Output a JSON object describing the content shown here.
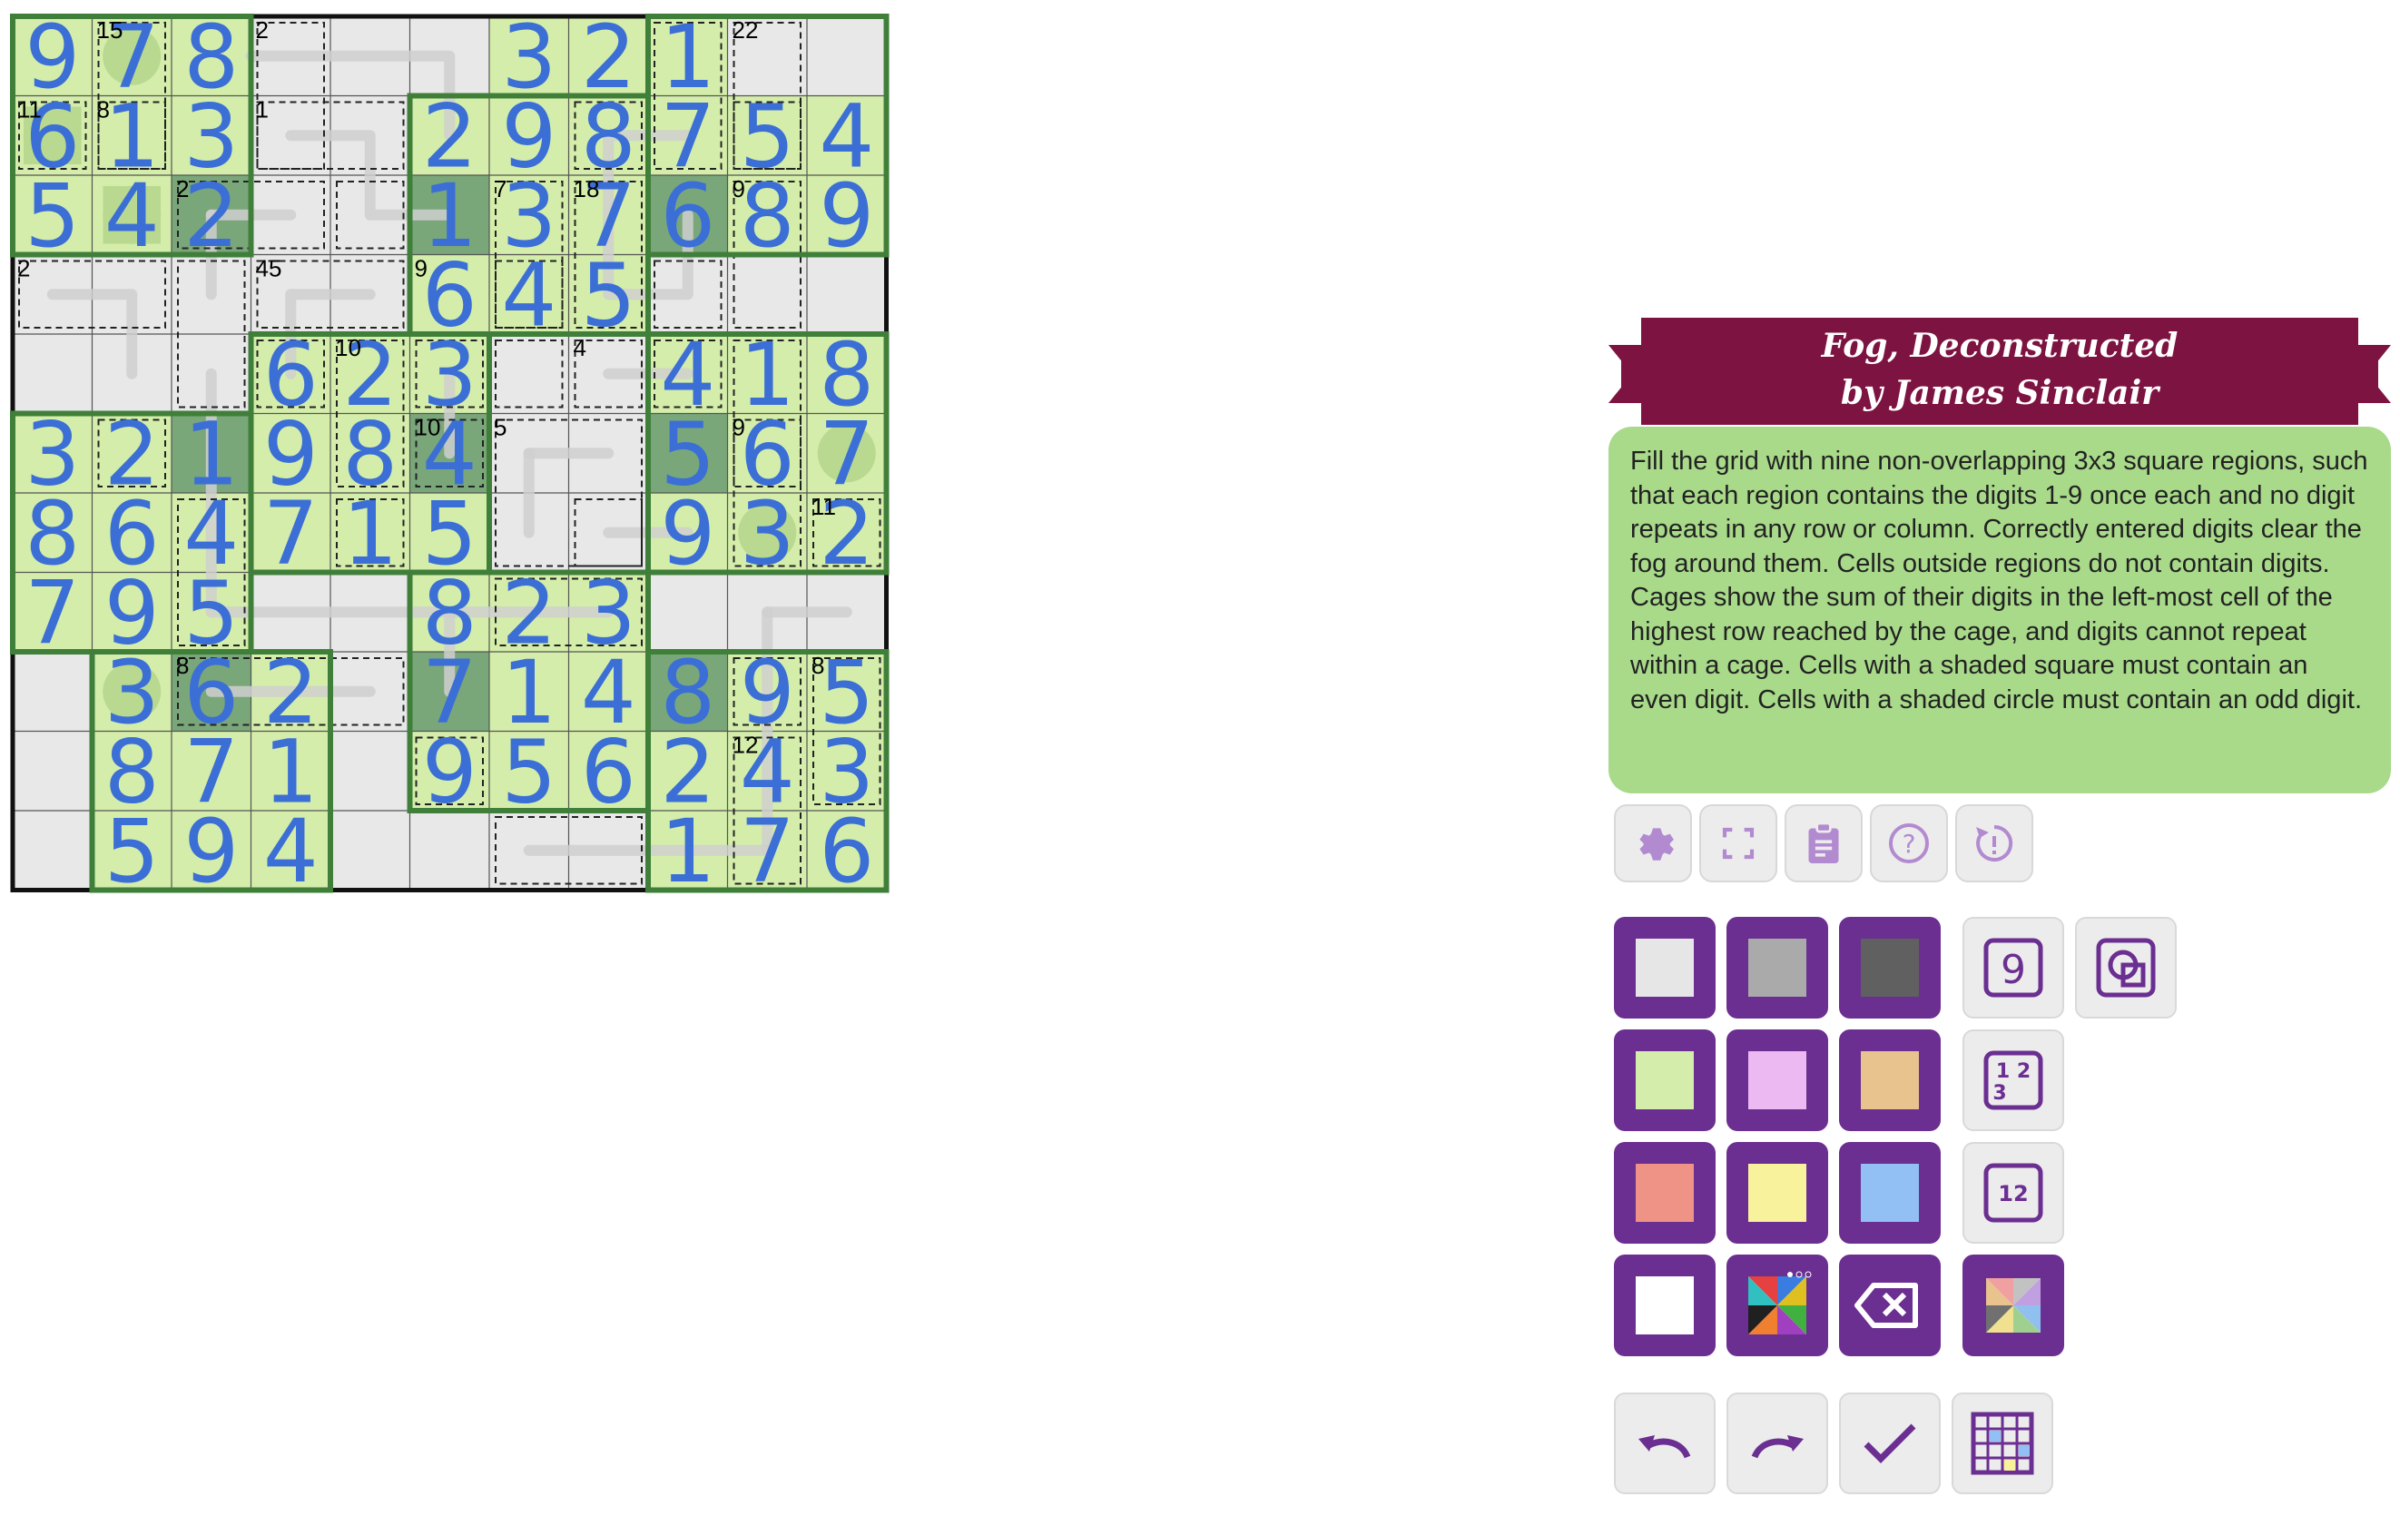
{
  "puzzle": {
    "title": "Fog, Deconstructed",
    "author": "by James Sinclair",
    "rules": "Fill the grid with nine non-overlapping 3x3 square regions, such that each region contains the digits 1-9 once each and no digit repeats in any row or column. Correctly entered digits clear the fog around them. Cells outside regions do not contain digits. Cages show the sum of their digits in the left-most cell of the highest row reached by the cage, and digits cannot repeat within a cage. Cells with a shaded square must contain an even digit. Cells with a shaded circle must contain an odd digit."
  },
  "grid": {
    "rows": [
      "978...321",
      "613.2987.54",
      "542.137689",
      ".....645...",
      "....6234.418",
      "32198456.67",
      "8647159.32",
      "795.823...",
      ".362.71489.5",
      ".871.9562.43",
      ".594...176"
    ],
    "cells": [
      [
        "9",
        "7",
        "8",
        "",
        "",
        "",
        "3",
        "2",
        "1"
      ],
      [
        "6",
        "1",
        "3",
        "",
        "",
        "2",
        "9",
        "8",
        "7",
        "5",
        "4"
      ],
      [
        "5",
        "4",
        "2",
        "",
        "",
        "1",
        "3",
        "7",
        "6",
        "8",
        "9"
      ],
      [
        "",
        "",
        "",
        "",
        "",
        "6",
        "4",
        "5",
        "",
        "",
        ""
      ],
      [
        "",
        "",
        "",
        "6",
        "2",
        "3",
        "",
        "",
        "4",
        "1",
        "8"
      ],
      [
        "3",
        "2",
        "1",
        "9",
        "8",
        "4",
        "",
        "",
        "5",
        "6",
        "7"
      ],
      [
        "8",
        "6",
        "4",
        "7",
        "1",
        "5",
        "",
        "",
        "9",
        "3",
        "2"
      ],
      [
        "7",
        "9",
        "5",
        "",
        "",
        "8",
        "2",
        "3",
        "",
        "",
        ""
      ],
      [
        "",
        "3",
        "6",
        "2",
        "",
        "7",
        "1",
        "4",
        "8",
        "9",
        "5"
      ],
      [
        "",
        "8",
        "7",
        "1",
        "",
        "9",
        "5",
        "6",
        "2",
        "4",
        "3"
      ],
      [
        "",
        "5",
        "9",
        "4",
        "",
        "",
        "",
        "",
        "1",
        "7",
        "6"
      ]
    ],
    "cage_sums": [
      "15",
      "2",
      "22",
      "11",
      "8",
      "1",
      "2",
      "7",
      "18",
      "9",
      "2",
      "45",
      "9",
      "10",
      "4",
      "10",
      "5",
      "9",
      "11",
      "8",
      "8",
      "12"
    ],
    "colors": {
      "fog": "#e8e8e8",
      "cleared": "#d4edaa",
      "even_square": "#7aa77a",
      "digit": "#3b6fd6",
      "region": "#3f7f3a"
    }
  },
  "toolbar": {
    "icons": [
      "gear-icon",
      "fullscreen-icon",
      "clipboard-icon",
      "help-icon",
      "restart-icon"
    ]
  },
  "palette": {
    "swatches": [
      "#e6e6e6",
      "#aaaaaa",
      "#606060",
      "#d4edaa",
      "#ecb9f2",
      "#e9c38e",
      "#ee9385",
      "#f9f29c",
      "#92c0f4",
      "#ffffff"
    ],
    "modes": [
      "9",
      "1 2 3",
      "12"
    ]
  }
}
